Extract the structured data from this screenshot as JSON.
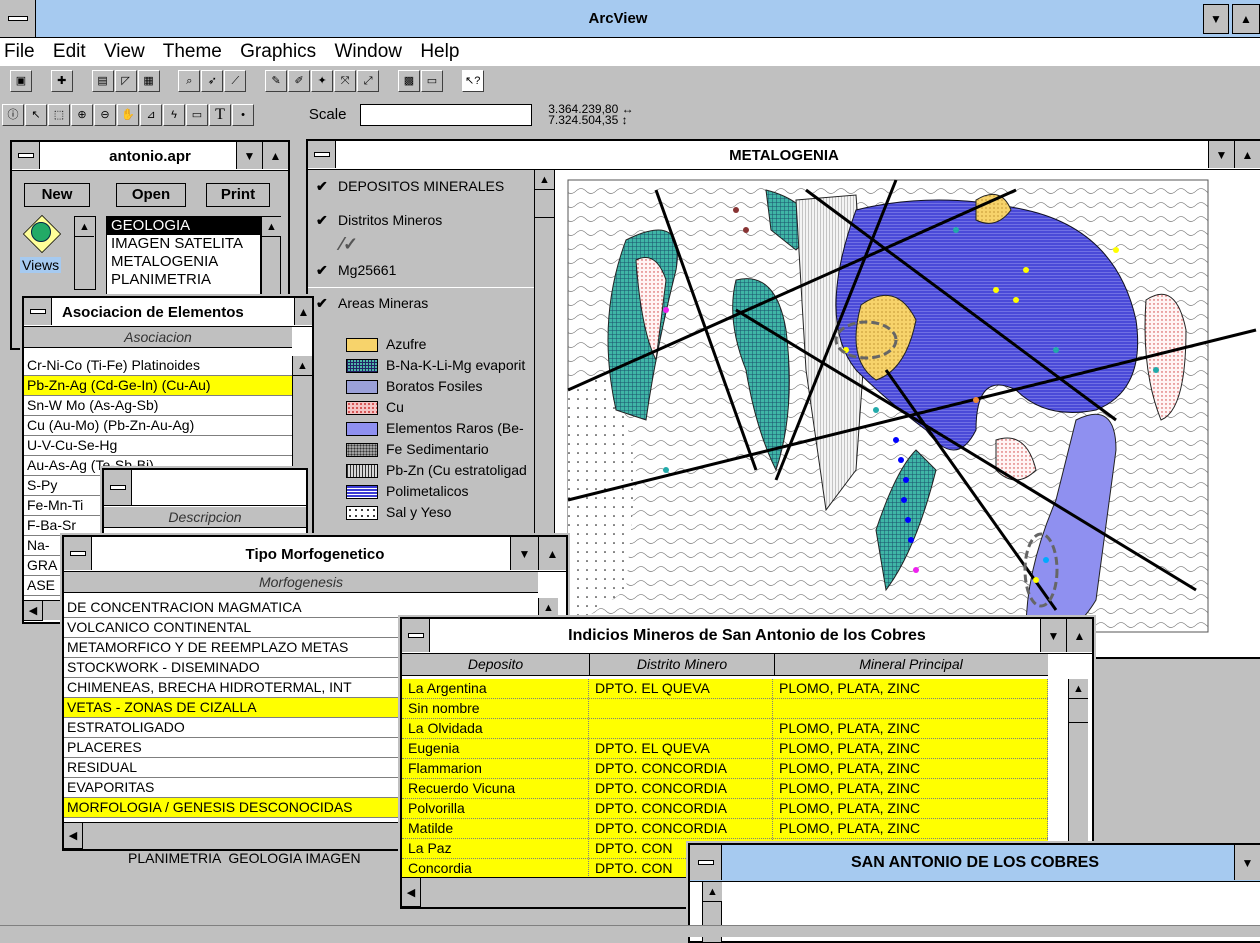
{
  "app": {
    "title": "ArcView"
  },
  "menu": [
    "File",
    "Edit",
    "View",
    "Theme",
    "Graphics",
    "Window",
    "Help"
  ],
  "toolbar2": {
    "scale_label": "Scale",
    "coord_x": "3.364.239,80",
    "coord_y": "7.324.504,35"
  },
  "project": {
    "title": "antonio.apr",
    "buttons": {
      "new": "New",
      "open": "Open",
      "print": "Print"
    },
    "views_label": "Views",
    "views": [
      "GEOLOGIA",
      "IMAGEN SATELITA",
      "METALOGENIA",
      "PLANIMETRIA"
    ]
  },
  "asociacion": {
    "title": "Asociacion de Elementos",
    "header": "Asociacion",
    "rows": [
      "Cr-Ni-Co (Ti-Fe) Platinoides",
      "Pb-Zn-Ag (Cd-Ge-In) (Cu-Au)",
      "Sn-W Mo (As-Ag-Sb)",
      "Cu (Au-Mo) (Pb-Zn-Au-Ag)",
      "U-V-Cu-Se-Hg",
      "Au-As-Ag (Te-Sb-Bi)",
      "S-Py",
      "Fe-Mn-Ti",
      "F-Ba-Sr",
      "Na-",
      "GRA",
      "ASE"
    ]
  },
  "descripcion": {
    "header": "Descripcion"
  },
  "metalogenia": {
    "title": "METALOGENIA",
    "themes": [
      {
        "name": "DEPOSITOS MINERALES"
      },
      {
        "name": "Distritos Mineros"
      },
      {
        "name": "Mg25661"
      },
      {
        "name": "Areas Mineras"
      }
    ],
    "legend": [
      {
        "label": "Azufre",
        "color": "#f7d36b"
      },
      {
        "label": "B-Na-K-Li-Mg evaporit",
        "color": "#4db8a8"
      },
      {
        "label": "Boratos Fosiles",
        "color": "#9aa0d8"
      },
      {
        "label": "Cu",
        "color": "#f4c4c4"
      },
      {
        "label": "Elementos Raros (Be-",
        "color": "#8f90f0"
      },
      {
        "label": "Fe Sedimentario",
        "color": "#a0a0a0"
      },
      {
        "label": "Pb-Zn (Cu estratoligad",
        "color": "#d8d8d8"
      },
      {
        "label": "Polimetalicos",
        "color": "#3b3bd4"
      },
      {
        "label": "Sal y Yeso",
        "color": "#ffffff"
      }
    ]
  },
  "morfo": {
    "title": "Tipo Morfogenetico",
    "header": "Morfogenesis",
    "rows": [
      {
        "text": "DE CONCENTRACION MAGMATICA",
        "hl": false
      },
      {
        "text": "VOLCANICO CONTINENTAL",
        "hl": false
      },
      {
        "text": "METAMORFICO Y DE REEMPLAZO METAS",
        "hl": false
      },
      {
        "text": "STOCKWORK - DISEMINADO",
        "hl": false
      },
      {
        "text": "CHIMENEAS, BRECHA HIDROTERMAL, INT",
        "hl": false
      },
      {
        "text": "VETAS - ZONAS DE CIZALLA",
        "hl": true
      },
      {
        "text": "ESTRATOLIGADO",
        "hl": false
      },
      {
        "text": "PLACERES",
        "hl": false
      },
      {
        "text": "RESIDUAL",
        "hl": false
      },
      {
        "text": "EVAPORITAS",
        "hl": false
      },
      {
        "text": "MORFOLOGIA / GENESIS DESCONOCIDAS",
        "hl": true
      }
    ]
  },
  "indicios": {
    "title": "Indicios Mineros de San Antonio de los Cobres",
    "columns": [
      "Deposito",
      "Distrito Minero",
      "Mineral Principal"
    ],
    "rows": [
      [
        "La Argentina",
        "DPTO. EL QUEVA",
        "PLOMO, PLATA, ZINC"
      ],
      [
        "Sin nombre",
        "",
        ""
      ],
      [
        "La Olvidada",
        "",
        "PLOMO, PLATA, ZINC"
      ],
      [
        "Eugenia",
        "DPTO. EL QUEVA",
        "PLOMO, PLATA, ZINC"
      ],
      [
        "Flammarion",
        "DPTO. CONCORDIA",
        "PLOMO, PLATA, ZINC"
      ],
      [
        "Recuerdo Vicuna",
        "DPTO. CONCORDIA",
        "PLOMO, PLATA, ZINC"
      ],
      [
        "Polvorilla",
        "DPTO. CONCORDIA",
        "PLOMO, PLATA, ZINC"
      ],
      [
        "Matilde",
        "DPTO. CONCORDIA",
        "PLOMO, PLATA, ZINC"
      ],
      [
        "La Paz",
        "DPTO. CON",
        ""
      ],
      [
        "Concordia",
        "DPTO. CON",
        ""
      ]
    ]
  },
  "sanantonio": {
    "title": "SAN ANTONIO DE LOS COBRES"
  },
  "bottom_icons_text": "PLANIMETRIA  GEOLOGIA IMAGEN"
}
